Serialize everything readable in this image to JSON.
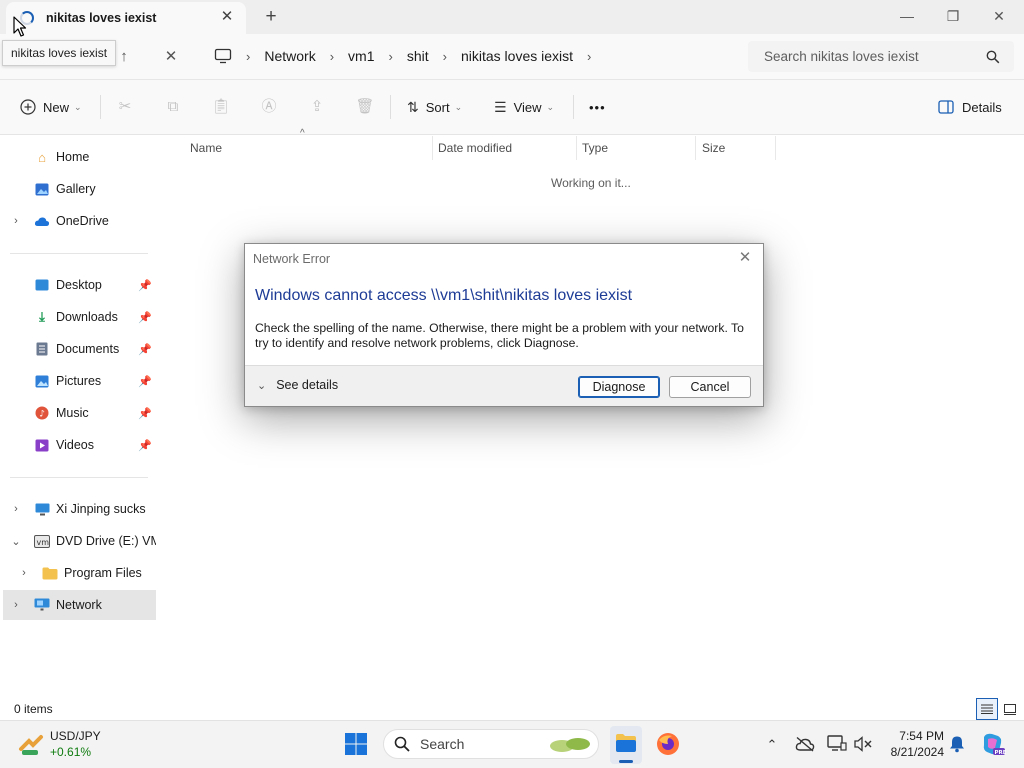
{
  "tab": {
    "title": "nikitas loves iexist",
    "close_glyph": "✕",
    "new_tab_glyph": "+"
  },
  "window_controls": {
    "minimize": "—",
    "maximize": "❐",
    "close": "✕"
  },
  "tooltip": "nikitas loves iexist",
  "navigation": {
    "up_glyph": "↑",
    "stop_glyph": "✕"
  },
  "breadcrumb": [
    "Network",
    "vm1",
    "shit",
    "nikitas loves iexist"
  ],
  "breadcrumb_separator": "›",
  "search": {
    "placeholder": "Search nikitas loves iexist"
  },
  "commandbar": {
    "new_label": "New",
    "sort_label": "Sort",
    "view_label": "View",
    "more_label": "•••",
    "details_label": "Details",
    "dropdown_glyph": "⌄"
  },
  "sidebar": {
    "top": [
      {
        "label": "Home",
        "icon": "home-icon",
        "color": "#e8a13a"
      },
      {
        "label": "Gallery",
        "icon": "gallery-icon",
        "color": "#2f6fd0"
      },
      {
        "label": "OneDrive",
        "icon": "cloud-icon",
        "color": "#1e73d8",
        "expandable": true
      }
    ],
    "quick_access": [
      {
        "label": "Desktop",
        "icon": "desktop-icon",
        "color": "#2e8ad8",
        "pinned": true
      },
      {
        "label": "Downloads",
        "icon": "download-icon",
        "color": "#1d9a55",
        "pinned": true
      },
      {
        "label": "Documents",
        "icon": "documents-icon",
        "color": "#6b7a90",
        "pinned": true
      },
      {
        "label": "Pictures",
        "icon": "pictures-icon",
        "color": "#2f7fd8",
        "pinned": true
      },
      {
        "label": "Music",
        "icon": "music-icon",
        "color": "#e0543b",
        "pinned": true
      },
      {
        "label": "Videos",
        "icon": "videos-icon",
        "color": "#8a3fc8",
        "pinned": true
      }
    ],
    "devices": [
      {
        "label": "Xi Jinping sucks",
        "icon": "pc-icon",
        "color": "#2e8ad8",
        "expand": "›"
      },
      {
        "label": "DVD Drive (E:) VMw",
        "icon": "dvd-icon",
        "color": "#555555",
        "expand": "⌄"
      },
      {
        "label": "Program Files",
        "icon": "folder-icon",
        "color": "#f2c14e",
        "expand": "›",
        "indent": true
      },
      {
        "label": "Network",
        "icon": "network-icon",
        "color": "#2e8ad8",
        "expand": "›",
        "selected": true
      }
    ],
    "pin_glyph": "📌"
  },
  "columns": [
    "Name",
    "Date modified",
    "Type",
    "Size"
  ],
  "sort_indicator": "^",
  "loading_text": "Working on it...",
  "dialog": {
    "title": "Network Error",
    "heading": "Windows cannot access \\\\vm1\\shit\\nikitas loves iexist",
    "message": "Check the spelling of the name. Otherwise, there might be a problem with your network. To try to identify and resolve network problems, click Diagnose.",
    "see_details": "See details",
    "diagnose_button": "Diagnose",
    "cancel_button": "Cancel",
    "close_glyph": "✕"
  },
  "status": {
    "items": "0 items"
  },
  "taskbar": {
    "widget_title": "USD/JPY",
    "widget_value": "+0.61%",
    "search_placeholder": "Search",
    "time": "7:54 PM",
    "date": "8/21/2024",
    "accent": "#1a5fb4"
  }
}
